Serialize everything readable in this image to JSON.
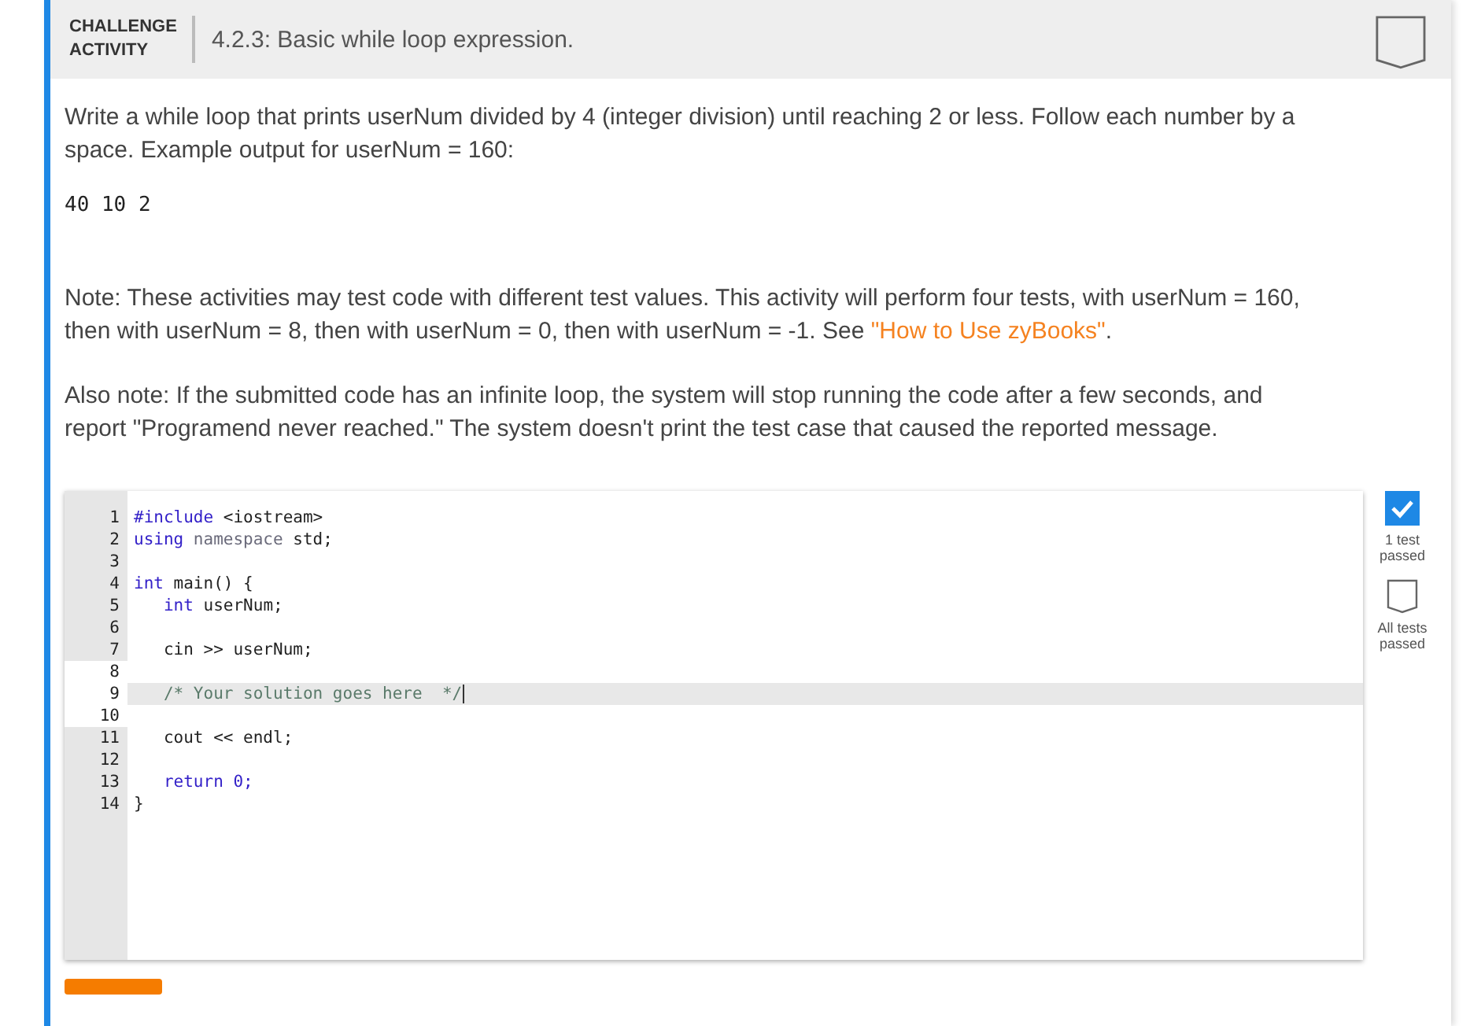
{
  "header": {
    "tag": [
      "CHALLENGE",
      "ACTIVITY"
    ],
    "title": "4.2.3: Basic while loop expression.",
    "completed": false
  },
  "instructions": "Write a while loop that prints userNum divided by 4 (integer division) until reaching 2 or less. Follow each number by a space. Example output for userNum = 160:",
  "example_output": "40 10 2",
  "note": {
    "text": "Note: These activities may test code with different test values. This activity will perform four tests, with userNum = 160, then with userNum = 8, then with userNum = 0, then with userNum = -1. See ",
    "link": "\"How to Use zyBooks\"",
    "after": "."
  },
  "also_note": "Also note: If the submitted code has an infinite loop, the system will stop running the code after a few seconds, and report \"Programend never reached.\" The system doesn't print the test case that caused the reported message.",
  "code_lines": [
    {
      "number": "1",
      "editable": false,
      "highlighted": false,
      "tokens": [
        {
          "kind": "keyword",
          "text": "#include"
        },
        {
          "kind": "plain",
          "text": " <iostream>"
        }
      ]
    },
    {
      "number": "2",
      "editable": false,
      "highlighted": false,
      "tokens": [
        {
          "kind": "keyword",
          "text": "using"
        },
        {
          "kind": "dim",
          "text": " namespace"
        },
        {
          "kind": "plain",
          "text": " std;"
        }
      ]
    },
    {
      "number": "3",
      "editable": false,
      "highlighted": false
    },
    {
      "number": "4",
      "editable": false,
      "highlighted": false,
      "tokens": [
        {
          "kind": "keyword",
          "text": "int"
        },
        {
          "kind": "plain",
          "text": " main() {"
        }
      ]
    },
    {
      "number": "5",
      "editable": false,
      "highlighted": false,
      "tokens": [
        {
          "kind": "keyword",
          "text": "   int"
        },
        {
          "kind": "plain",
          "text": " userNum;"
        }
      ]
    },
    {
      "number": "6",
      "editable": false,
      "highlighted": false
    },
    {
      "number": "7",
      "editable": false,
      "highlighted": false,
      "tokens": [
        {
          "kind": "plain",
          "text": "   cin >> userNum;"
        }
      ]
    },
    {
      "number": "8",
      "editable": true,
      "highlighted": false
    },
    {
      "number": "9",
      "editable": true,
      "highlighted": true,
      "tokens": [
        {
          "kind": "comment",
          "text": "   /* Your solution goes here  */"
        }
      ]
    },
    {
      "number": "10",
      "editable": true,
      "highlighted": false
    },
    {
      "number": "11",
      "editable": false,
      "highlighted": false,
      "tokens": [
        {
          "kind": "plain",
          "text": "   cout << endl;"
        }
      ]
    },
    {
      "number": "12",
      "editable": false,
      "highlighted": false
    },
    {
      "number": "13",
      "editable": false,
      "highlighted": false,
      "tokens": [
        {
          "kind": "keyword",
          "text": "   return"
        },
        {
          "kind": "number",
          "text": " 0;"
        }
      ]
    },
    {
      "number": "14",
      "editable": false,
      "highlighted": false,
      "tokens": [
        {
          "kind": "plain",
          "text": "}"
        }
      ]
    }
  ],
  "tests": [
    {
      "label": "1 test passed",
      "passed": true
    },
    {
      "label": "All tests passed",
      "passed": false
    }
  ]
}
